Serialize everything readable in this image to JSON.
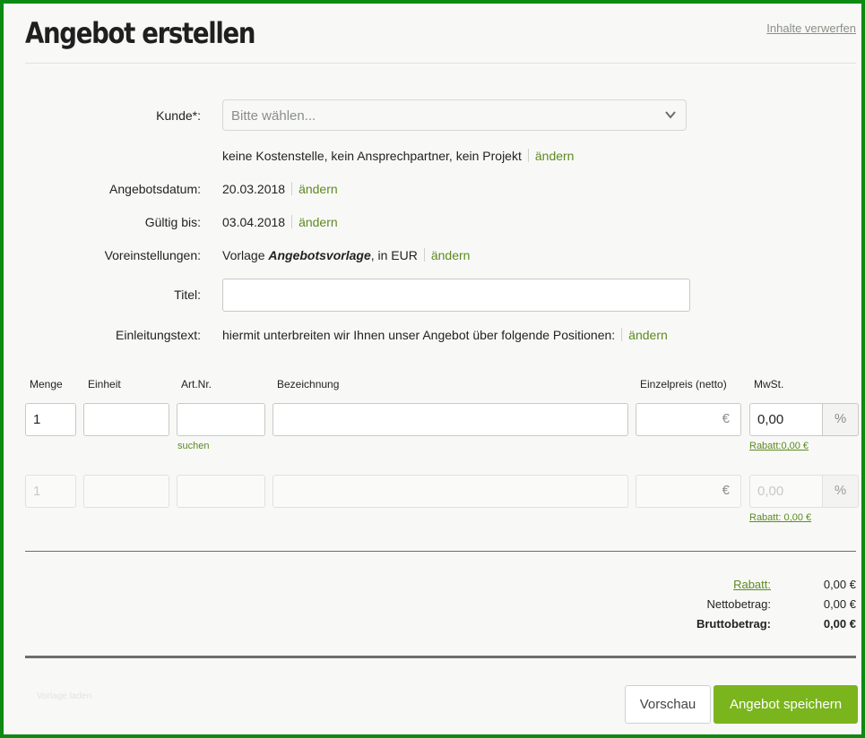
{
  "header": {
    "title": "Angebot erstellen",
    "discard_label": "Inhalte verwerfen"
  },
  "form": {
    "customer": {
      "label": "Kunde*:",
      "placeholder": "Bitte wählen...",
      "details": "keine Kostenstelle, kein Ansprechpartner, kein Projekt",
      "change_label": "ändern"
    },
    "offer_date": {
      "label": "Angebotsdatum:",
      "value": "20.03.2018",
      "change_label": "ändern"
    },
    "valid_until": {
      "label": "Gültig bis:",
      "value": "03.04.2018",
      "change_label": "ändern"
    },
    "presets": {
      "label": "Voreinstellungen:",
      "prefix": "Vorlage ",
      "template": "Angebotsvorlage",
      "suffix": ", in EUR",
      "change_label": "ändern"
    },
    "title_field": {
      "label": "Titel:",
      "value": ""
    },
    "intro": {
      "label": "Einleitungstext:",
      "value": "hiermit unterbreiten wir Ihnen unser Angebot über folgende Positionen:",
      "change_label": "ändern"
    }
  },
  "positions": {
    "columns": {
      "quantity": "Menge",
      "unit": "Einheit",
      "article": "Art.Nr.",
      "description": "Bezeichnung",
      "unit_price": "Einzelpreis (netto)",
      "vat": "MwSt."
    },
    "currency_symbol": "€",
    "percent_symbol": "%",
    "rows": [
      {
        "quantity": "1",
        "unit": "",
        "article": "",
        "description": "",
        "price": "",
        "vat": "0,00",
        "search_label": "suchen",
        "discount_label": "Rabatt:0,00 €"
      },
      {
        "quantity": "1",
        "unit": "",
        "article": "",
        "description": "",
        "price": "",
        "vat": "0,00",
        "discount_label": "Rabatt: 0,00 €"
      }
    ]
  },
  "totals": {
    "discount": {
      "label": "Rabatt:",
      "value": "0,00 €"
    },
    "net": {
      "label": "Nettobetrag:",
      "value": "0,00 €"
    },
    "gross": {
      "label": "Bruttobetrag:",
      "value": "0,00 €"
    }
  },
  "footer": {
    "ghost_text": "Vorlage laden",
    "preview_label": "Vorschau",
    "save_label": "Angebot speichern"
  },
  "colors": {
    "accent": "#7ab51d",
    "link": "#5b8a22",
    "frame": "#0d8a13"
  }
}
